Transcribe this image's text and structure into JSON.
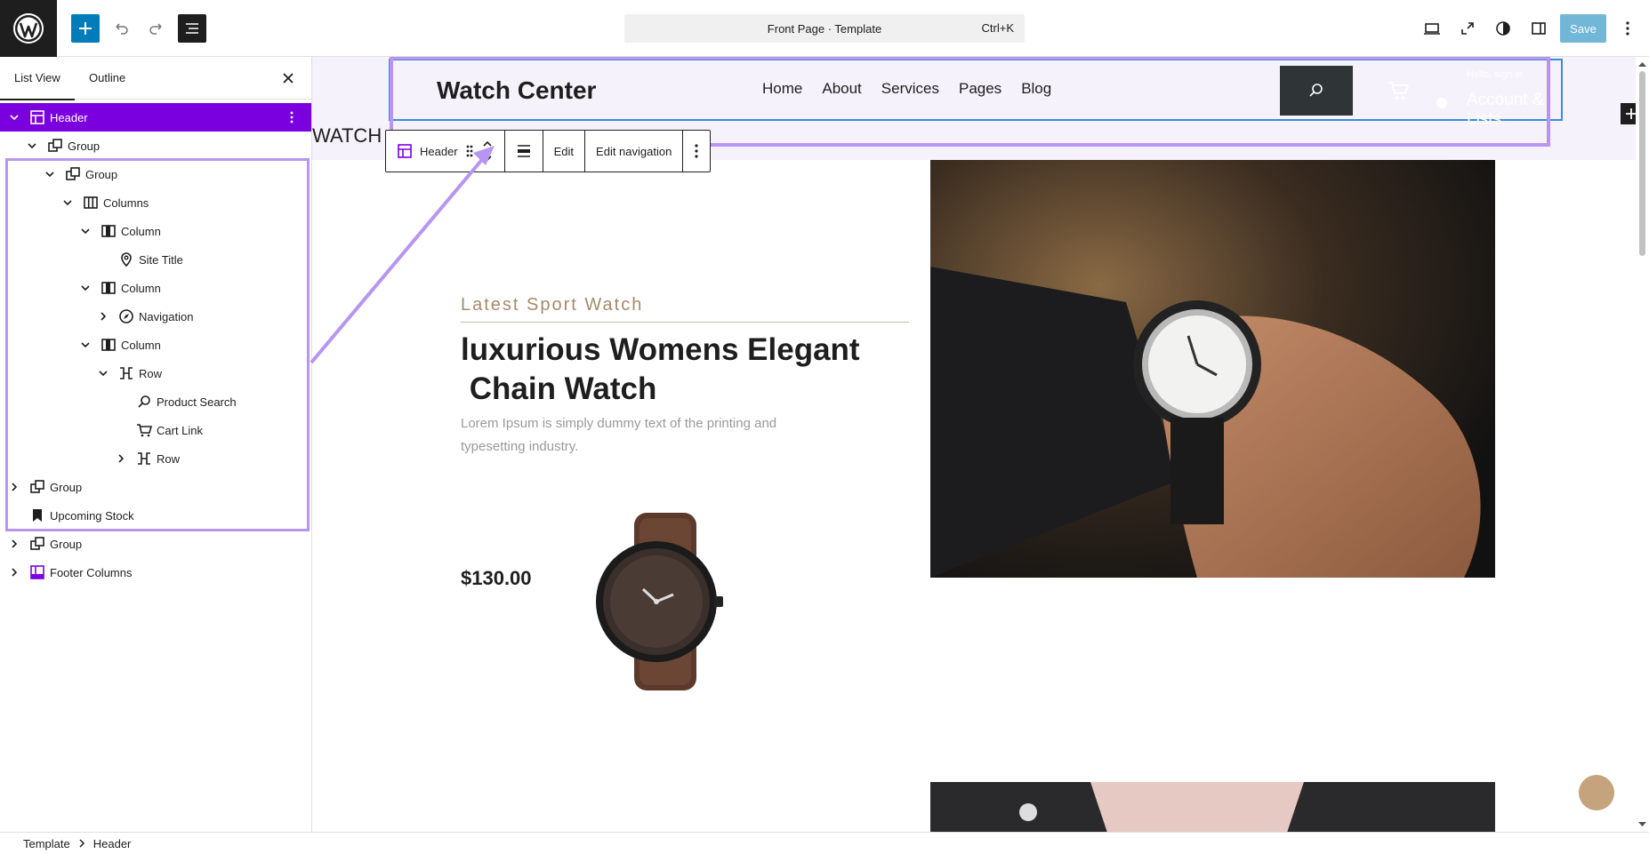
{
  "topbar": {
    "command_title": "Front Page · Template",
    "command_shortcut": "Ctrl+K",
    "save_label": "Save"
  },
  "panel": {
    "tab_list": "List View",
    "tab_outline": "Outline",
    "tree": [
      {
        "label": "Header",
        "depth": 0,
        "icon": "template-part-icon",
        "chevron": "down",
        "selected": true
      },
      {
        "label": "Group",
        "depth": 1,
        "icon": "group-icon",
        "chevron": "down"
      },
      {
        "label": "Group",
        "depth": 2,
        "icon": "group-icon",
        "chevron": "down"
      },
      {
        "label": "Columns",
        "depth": 3,
        "icon": "columns-icon",
        "chevron": "down"
      },
      {
        "label": "Column",
        "depth": 4,
        "icon": "column-icon",
        "chevron": "down"
      },
      {
        "label": "Site Title",
        "depth": 5,
        "icon": "map-pin-icon",
        "chevron": "none"
      },
      {
        "label": "Column",
        "depth": 4,
        "icon": "column-icon",
        "chevron": "down"
      },
      {
        "label": "Navigation",
        "depth": 5,
        "icon": "navigation-icon",
        "chevron": "right"
      },
      {
        "label": "Column",
        "depth": 4,
        "icon": "column-icon",
        "chevron": "down"
      },
      {
        "label": "Row",
        "depth": 5,
        "icon": "row-icon",
        "chevron": "down"
      },
      {
        "label": "Product Search",
        "depth": 6,
        "icon": "search-icon",
        "chevron": "none"
      },
      {
        "label": "Cart Link",
        "depth": 6,
        "icon": "cart-icon",
        "chevron": "none"
      },
      {
        "label": "Row",
        "depth": 6,
        "icon": "row-icon",
        "chevron": "right"
      },
      {
        "label": "Group",
        "depth": 0,
        "icon": "group-icon",
        "chevron": "right"
      },
      {
        "label": "Upcoming Stock",
        "depth": 0,
        "icon": "bookmark-icon",
        "chevron": "none"
      },
      {
        "label": "Group",
        "depth": 0,
        "icon": "group-icon",
        "chevron": "right"
      },
      {
        "label": "Footer Columns",
        "depth": 0,
        "icon": "footer-part-icon",
        "chevron": "right"
      }
    ]
  },
  "canvas": {
    "site_title": "Watch Center",
    "nav": [
      "Home",
      "About",
      "Services",
      "Pages",
      "Blog"
    ],
    "account_small": "Hello, sign in",
    "account_big": "Account & Lists",
    "watch_text": "WATCH",
    "toolbar": {
      "block_name": "Header",
      "edit": "Edit",
      "edit_navigation": "Edit navigation"
    },
    "hero": {
      "eyebrow": "Latest Sport Watch",
      "title_line1": "luxurious Womens Elegant",
      "title_line2": " Chain Watch",
      "desc": "Lorem Ipsum is simply dummy text of the printing and typesetting industry.",
      "price": "$130.00"
    }
  },
  "breadcrumb": {
    "root": "Template",
    "current": "Header"
  },
  "colors": {
    "accent": "#007cba",
    "selection": "#7a00df",
    "highlight": "#b795f0"
  }
}
